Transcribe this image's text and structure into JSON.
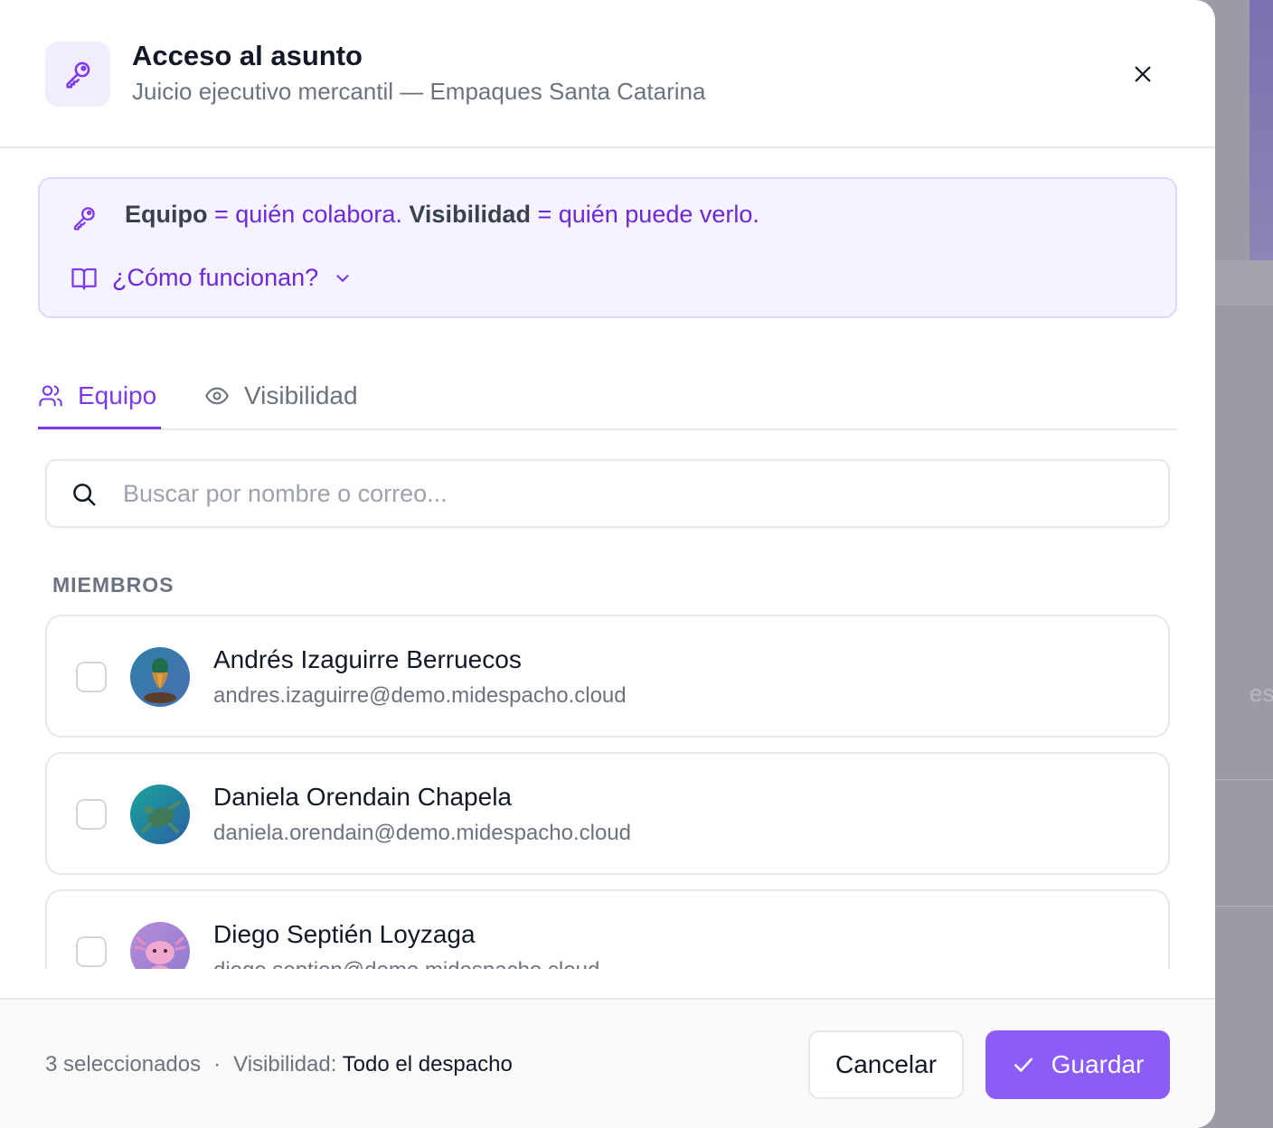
{
  "header": {
    "title": "Acceso al asunto",
    "subtitle": "Juicio ejecutivo mercantil — Empaques Santa Catarina",
    "icon": "key-icon",
    "close_icon": "close-icon"
  },
  "info": {
    "team_term": "Equipo",
    "team_def": " = quién colabora. ",
    "vis_term": "Visibilidad",
    "vis_def": " = quién puede verlo.",
    "toggle_label": "¿Cómo funcionan?",
    "toggle_icon": "book-icon"
  },
  "tabs": [
    {
      "label": "Equipo",
      "icon": "users-icon",
      "active": true
    },
    {
      "label": "Visibilidad",
      "icon": "eye-icon",
      "active": false
    }
  ],
  "search": {
    "placeholder": "Buscar por nombre o correo...",
    "value": ""
  },
  "members_label": "MIEMBROS",
  "members": [
    {
      "name": "Andrés Izaguirre Berruecos",
      "email": "andres.izaguirre@demo.midespacho.cloud",
      "checked": false
    },
    {
      "name": "Daniela Orendain Chapela",
      "email": "daniela.orendain@demo.midespacho.cloud",
      "checked": false
    },
    {
      "name": "Diego Septién Loyzaga",
      "email": "diego.septien@demo.midespacho.cloud",
      "checked": false
    }
  ],
  "footer": {
    "selected_text": "3 seleccionados",
    "separator": "·",
    "visibility_label": "Visibilidad:",
    "visibility_value": "Todo el despacho",
    "cancel_label": "Cancelar",
    "save_label": "Guardar"
  },
  "colors": {
    "accent": "#7c3aed",
    "accent_button": "#8b5cf6",
    "info_bg": "#f5f3ff"
  }
}
